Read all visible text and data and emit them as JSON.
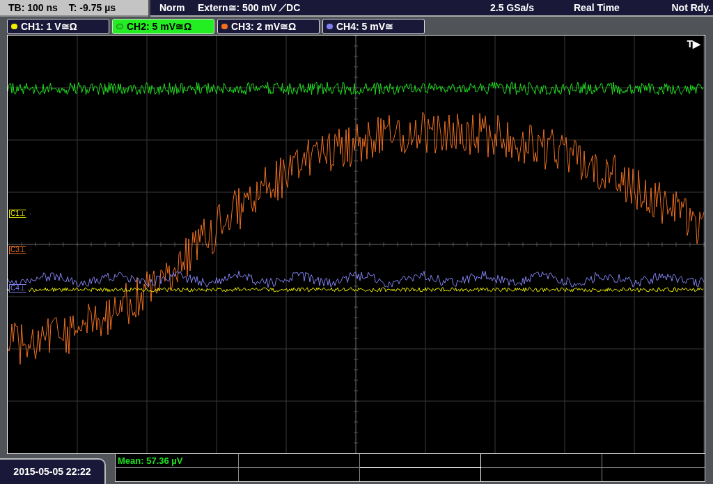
{
  "header": {
    "timebase": "TB: 100 ns",
    "trigger_time": "T: -9.75 µs",
    "mode": "Norm",
    "trigger_source": "Extern≅: 500 mV ⟋DC",
    "sample_rate": "2.5 GSa/s",
    "acquisition": "Real Time",
    "status": "Not Rdy."
  },
  "channels": [
    {
      "label": "CH1: 1 V≅Ω",
      "color": "#f0f000",
      "selected": false
    },
    {
      "label": "CH2: 5 mV≅Ω",
      "color": "#20e020",
      "selected": true
    },
    {
      "label": "CH3: 2 mV≅Ω",
      "color": "#f07020",
      "selected": false
    },
    {
      "label": "CH4: 5 mV≅",
      "color": "#8080f0",
      "selected": false
    }
  ],
  "markers": [
    {
      "label": "C1⊥",
      "color": "#f0f000"
    },
    {
      "label": "C3⊥",
      "color": "#f07020"
    },
    {
      "label": "C4⊥",
      "color": "#8080f0"
    }
  ],
  "trigger_marker": "T▶",
  "measurement": "Mean: 57.36 µV",
  "datetime": "2015-05-05 22:22"
}
